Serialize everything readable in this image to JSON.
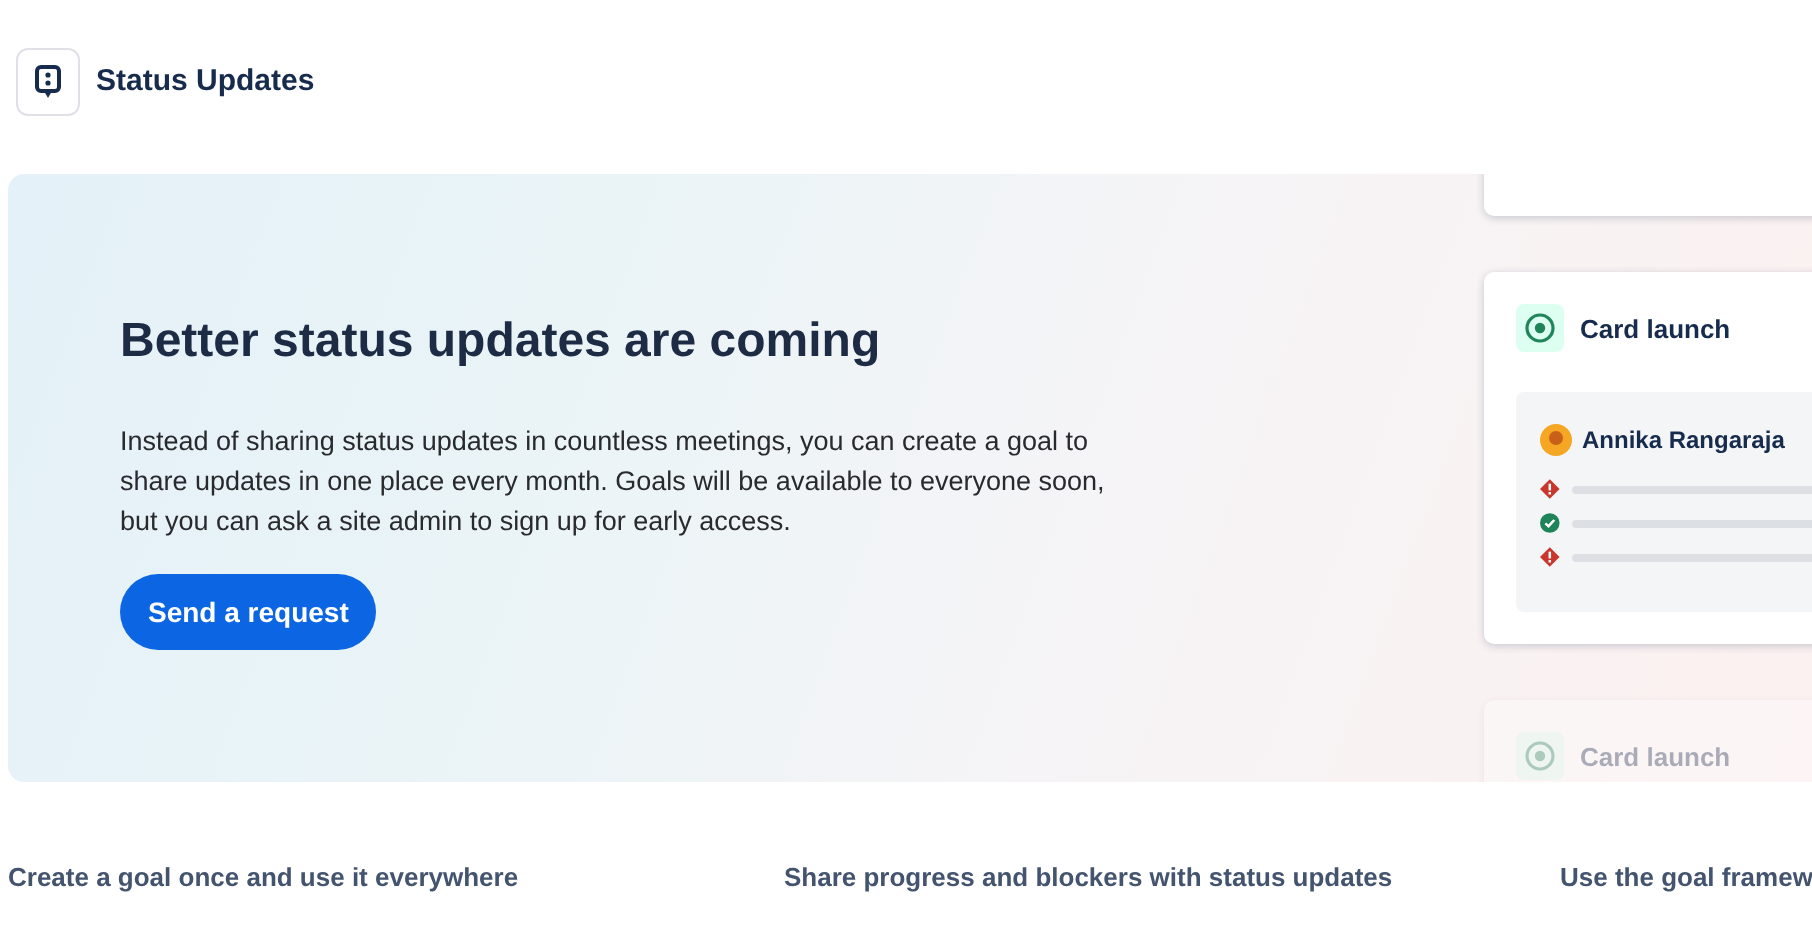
{
  "header": {
    "title": "Status Updates"
  },
  "banner": {
    "heading": "Better status updates are coming",
    "body": "Instead of sharing status updates in countless meetings, you can create a goal to share updates in one place every month. Goals will be available to everyone soon, but you can ask a site admin to sign up for early access.",
    "button": "Send a request"
  },
  "preview_cards": [
    {
      "title": "Card launch",
      "dimmed": false,
      "person": "Annika Rangaraja",
      "updates": [
        {
          "kind": "warning"
        },
        {
          "kind": "success"
        },
        {
          "kind": "warning"
        }
      ]
    },
    {
      "title": "Card launch",
      "dimmed": true
    }
  ],
  "features": [
    "Create a goal once and use it everywhere",
    "Share progress and blockers with status updates",
    "Use the goal framew"
  ]
}
